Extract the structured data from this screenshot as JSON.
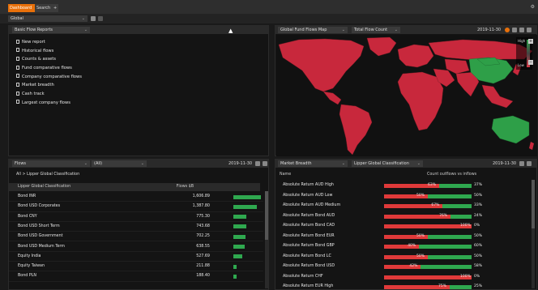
{
  "tabs": {
    "dashboard": "Dashboard",
    "search": "Search",
    "add": "+"
  },
  "global": {
    "selector": "Global"
  },
  "report_panel": {
    "dropdown": "Basic Flow Reports",
    "items": [
      "New report",
      "Historical flows",
      "Counts & assets",
      "Fund comparative flows",
      "Company comparative flows",
      "Market breadth",
      "Cash track",
      "Largest company flows"
    ]
  },
  "map_panel": {
    "dropdown_1": "Global Fund Flows Map",
    "dropdown_2": "Total Flow Count",
    "date": "2019-11-30",
    "legend_high": "High",
    "legend_low": "Low"
  },
  "flows_panel": {
    "dropdown_1": "Flows",
    "dropdown_2": "(All)",
    "date": "2019-11-30",
    "breadcrumb": "All > Lipper Global Classification",
    "col_name": "Lipper Global Classification",
    "col_value": "Flows $B",
    "rows": [
      {
        "name": "Bond INR",
        "value": "1,606.89",
        "frac": 1.0
      },
      {
        "name": "Bond USD Corporates",
        "value": "1,387.80",
        "frac": 0.86
      },
      {
        "name": "Bond CNY",
        "value": "775.30",
        "frac": 0.48
      },
      {
        "name": "Bond USD Short Term",
        "value": "743.68",
        "frac": 0.46
      },
      {
        "name": "Bond USD Government",
        "value": "702.25",
        "frac": 0.44
      },
      {
        "name": "Bond USD Medium Term",
        "value": "638.55",
        "frac": 0.4
      },
      {
        "name": "Equity India",
        "value": "527.69",
        "frac": 0.33
      },
      {
        "name": "Equity Taiwan",
        "value": "211.88",
        "frac": 0.13
      },
      {
        "name": "Bond PLN",
        "value": "188.40",
        "frac": 0.12
      }
    ]
  },
  "breadth_panel": {
    "dropdown_1": "Market Breadth",
    "dropdown_2": "Lipper Global Classification",
    "date": "2019-11-30",
    "col_name": "Name",
    "col_value": "Count outflows vs inflows",
    "rows": [
      {
        "name": "Absolute Return AUD High",
        "out": "63%",
        "in": "37%",
        "out_frac": 0.63
      },
      {
        "name": "Absolute Return AUD Low",
        "out": "50%",
        "in": "50%",
        "out_frac": 0.5
      },
      {
        "name": "Absolute Return AUD Medium",
        "out": "67%",
        "in": "33%",
        "out_frac": 0.67
      },
      {
        "name": "Absolute Return Bond AUD",
        "out": "76%",
        "in": "24%",
        "out_frac": 0.76
      },
      {
        "name": "Absolute Return Bond CAD",
        "out": "100%",
        "in": "0%",
        "out_frac": 1.0
      },
      {
        "name": "Absolute Return Bond EUR",
        "out": "50%",
        "in": "50%",
        "out_frac": 0.5
      },
      {
        "name": "Absolute Return Bond GBP",
        "out": "40%",
        "in": "60%",
        "out_frac": 0.4
      },
      {
        "name": "Absolute Return Bond LC",
        "out": "50%",
        "in": "50%",
        "out_frac": 0.5
      },
      {
        "name": "Absolute Return Bond USD",
        "out": "42%",
        "in": "58%",
        "out_frac": 0.42
      },
      {
        "name": "Absolute Return CHF",
        "out": "100%",
        "in": "0%",
        "out_frac": 1.0
      },
      {
        "name": "Absolute Return EUR High",
        "out": "75%",
        "in": "25%",
        "out_frac": 0.75
      }
    ]
  },
  "colors": {
    "accent": "#e8700a",
    "inflow": "#2fa84f",
    "outflow": "#e03a3a",
    "map_base": "#c8283c"
  }
}
